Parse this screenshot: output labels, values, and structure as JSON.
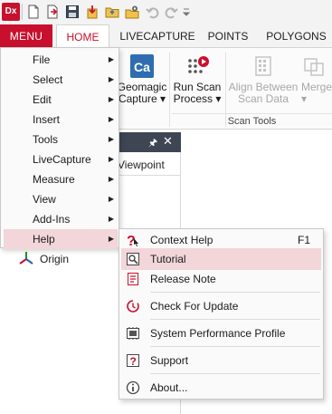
{
  "app": {
    "logo_text": "Dx"
  },
  "quick_access": {
    "icons": [
      "new-document-icon",
      "open-document-icon",
      "save-icon",
      "import-icon",
      "open-folder-icon",
      "settings-folder-icon",
      "undo-icon",
      "redo-icon",
      "customize-dropdown-icon"
    ]
  },
  "ribbon": {
    "menu_label": "MENU",
    "tabs": [
      "HOME",
      "LIVECAPTURE",
      "POINTS",
      "POLYGONS"
    ],
    "active_tab": "HOME",
    "buttons": [
      {
        "label_1": "Geomagic",
        "label_2": "Capture ▾",
        "icon": "ca-capture-icon",
        "enabled": true
      },
      {
        "label_1": "Run Scan",
        "label_2": "Process ▾",
        "icon": "run-scan-process-icon",
        "enabled": true
      },
      {
        "label_1": "Align Between",
        "label_2": "Scan Data",
        "icon": "align-scan-data-icon",
        "enabled": false
      },
      {
        "label_1": "Merge",
        "label_2": "▾",
        "icon": "merge-icon",
        "enabled": false
      }
    ],
    "group_label": "Scan Tools"
  },
  "panel": {
    "viewpoint_label": "Viewpoint",
    "origin_label": "Origin"
  },
  "main_menu": {
    "items": [
      {
        "label": "File",
        "has_submenu": true
      },
      {
        "label": "Select",
        "has_submenu": true
      },
      {
        "label": "Edit",
        "has_submenu": true
      },
      {
        "label": "Insert",
        "has_submenu": true
      },
      {
        "label": "Tools",
        "has_submenu": true
      },
      {
        "label": "LiveCapture",
        "has_submenu": true
      },
      {
        "label": "Measure",
        "has_submenu": true
      },
      {
        "label": "View",
        "has_submenu": true
      },
      {
        "label": "Add-Ins",
        "has_submenu": true
      },
      {
        "label": "Help",
        "has_submenu": true,
        "highlighted": true
      }
    ],
    "arrow_glyph": "▶"
  },
  "help_menu": {
    "items": [
      {
        "label": "Context Help",
        "shortcut": "F1",
        "icon": "context-help-icon"
      },
      {
        "label": "Tutorial",
        "shortcut": "",
        "icon": "tutorial-icon",
        "highlighted": true
      },
      {
        "label": "Release Note",
        "shortcut": "",
        "icon": "release-note-icon"
      },
      {
        "label": "Check For Update",
        "shortcut": "",
        "icon": "check-update-icon"
      },
      {
        "label": "System Performance Profile",
        "shortcut": "",
        "icon": "performance-profile-icon"
      },
      {
        "label": "Support",
        "shortcut": "",
        "icon": "support-icon"
      },
      {
        "label": "About...",
        "shortcut": "",
        "icon": "about-icon"
      }
    ]
  },
  "colors": {
    "accent": "#c8102e",
    "highlight": "#f2d6d9",
    "panel_header": "#3e4654"
  }
}
